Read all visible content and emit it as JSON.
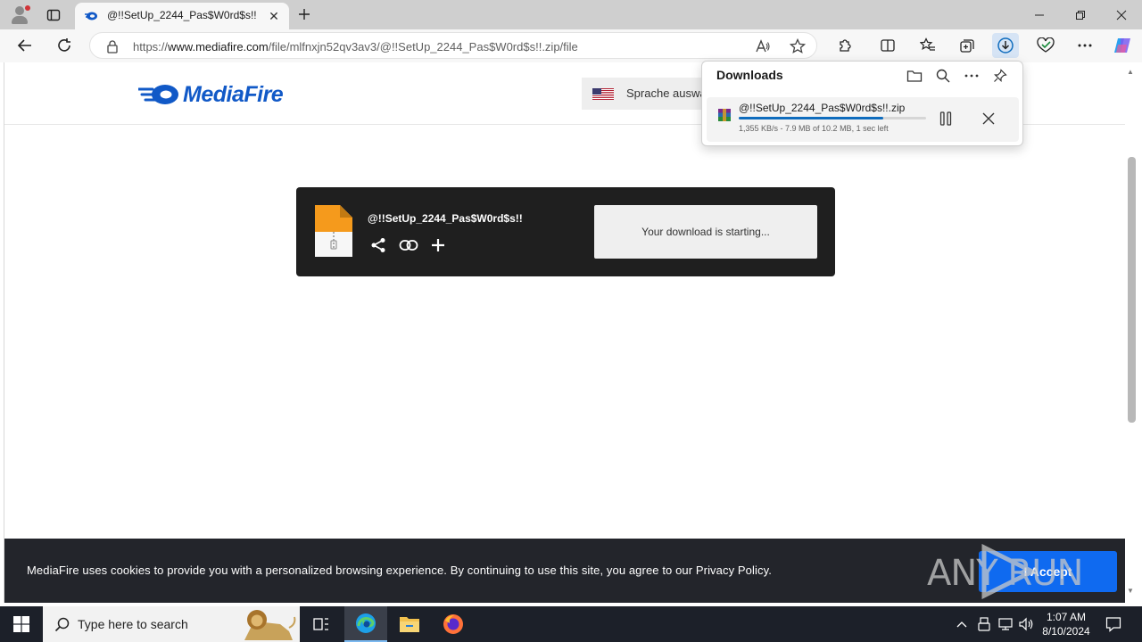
{
  "browser": {
    "tab": {
      "title": "@!!SetUp_2244_Pas$W0rd$s!!",
      "close_label": "✕"
    },
    "address": {
      "prefix": "https://",
      "domain": "www.mediafire.com",
      "path": "/file/mlfnxjn52qv3av3/@!!SetUp_2244_Pas$W0rd$s!!.zip/file"
    }
  },
  "downloads": {
    "title": "Downloads",
    "item": {
      "filename": "@!!SetUp_2244_Pas$W0rd$s!!.zip",
      "meta": "1,355 KB/s - 7.9 MB of 10.2 MB, 1 sec left",
      "progress": 0.77
    }
  },
  "page": {
    "logo": "MediaFire",
    "language_label": "Sprache auswä",
    "file": {
      "name": "@!!SetUp_2244_Pas$W0rd$s!!"
    },
    "status": "Your download is starting...",
    "cookie": {
      "text": "MediaFire uses cookies to provide you with a personalized browsing experience. By continuing to use this site, you agree to our Privacy Policy.",
      "accept_label": "I Accept"
    },
    "watermark": "ANY RUN"
  },
  "taskbar": {
    "search_placeholder": "Type here to search",
    "time": "1:07 AM",
    "date": "8/10/2024"
  },
  "colors": {
    "mediafire_blue": "#1159c7",
    "accept_blue": "#0f6af0",
    "progress_blue": "#0f6cbd"
  }
}
